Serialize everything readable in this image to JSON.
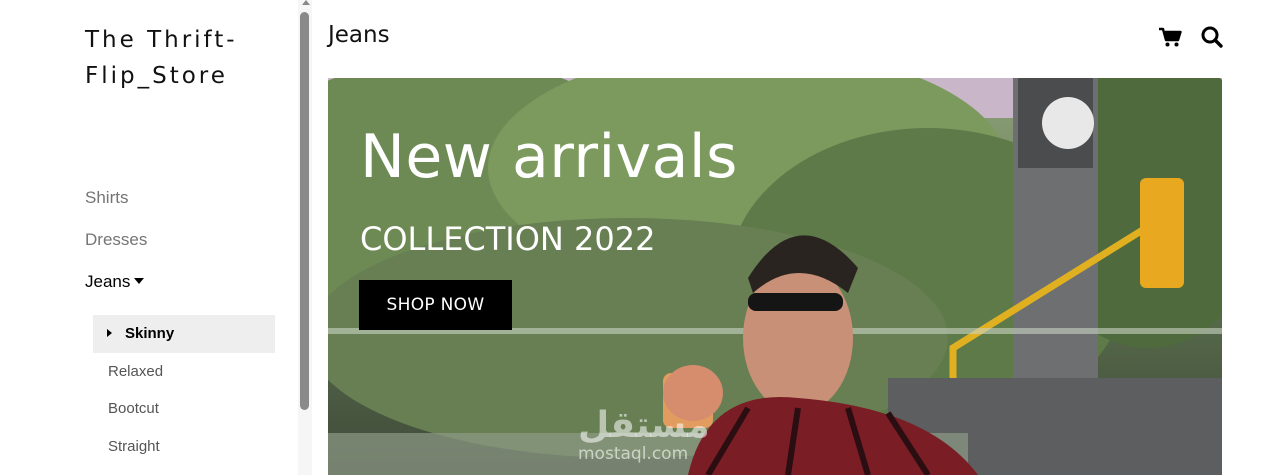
{
  "brand": {
    "logo_text": "The Thrift-Flip_Store"
  },
  "sidebar": {
    "items": [
      {
        "label": "Shirts"
      },
      {
        "label": "Dresses"
      },
      {
        "label": "Jeans"
      }
    ],
    "active": "Jeans",
    "subitems": [
      {
        "label": "Skinny"
      },
      {
        "label": "Relaxed"
      },
      {
        "label": "Bootcut"
      },
      {
        "label": "Straight"
      }
    ],
    "selected_subitem": "Skinny"
  },
  "header": {
    "title": "Jeans",
    "icons": [
      "cart-icon",
      "search-icon"
    ]
  },
  "hero": {
    "title": "New arrivals",
    "subtitle": "COLLECTION 2022",
    "button_label": "SHOP NOW"
  },
  "watermark": {
    "text_ar": "مستقل",
    "text": "mostaql.com"
  },
  "colors": {
    "accent": "#000000",
    "inactive_nav": "#757575",
    "selected_bg": "#eeeeee"
  }
}
